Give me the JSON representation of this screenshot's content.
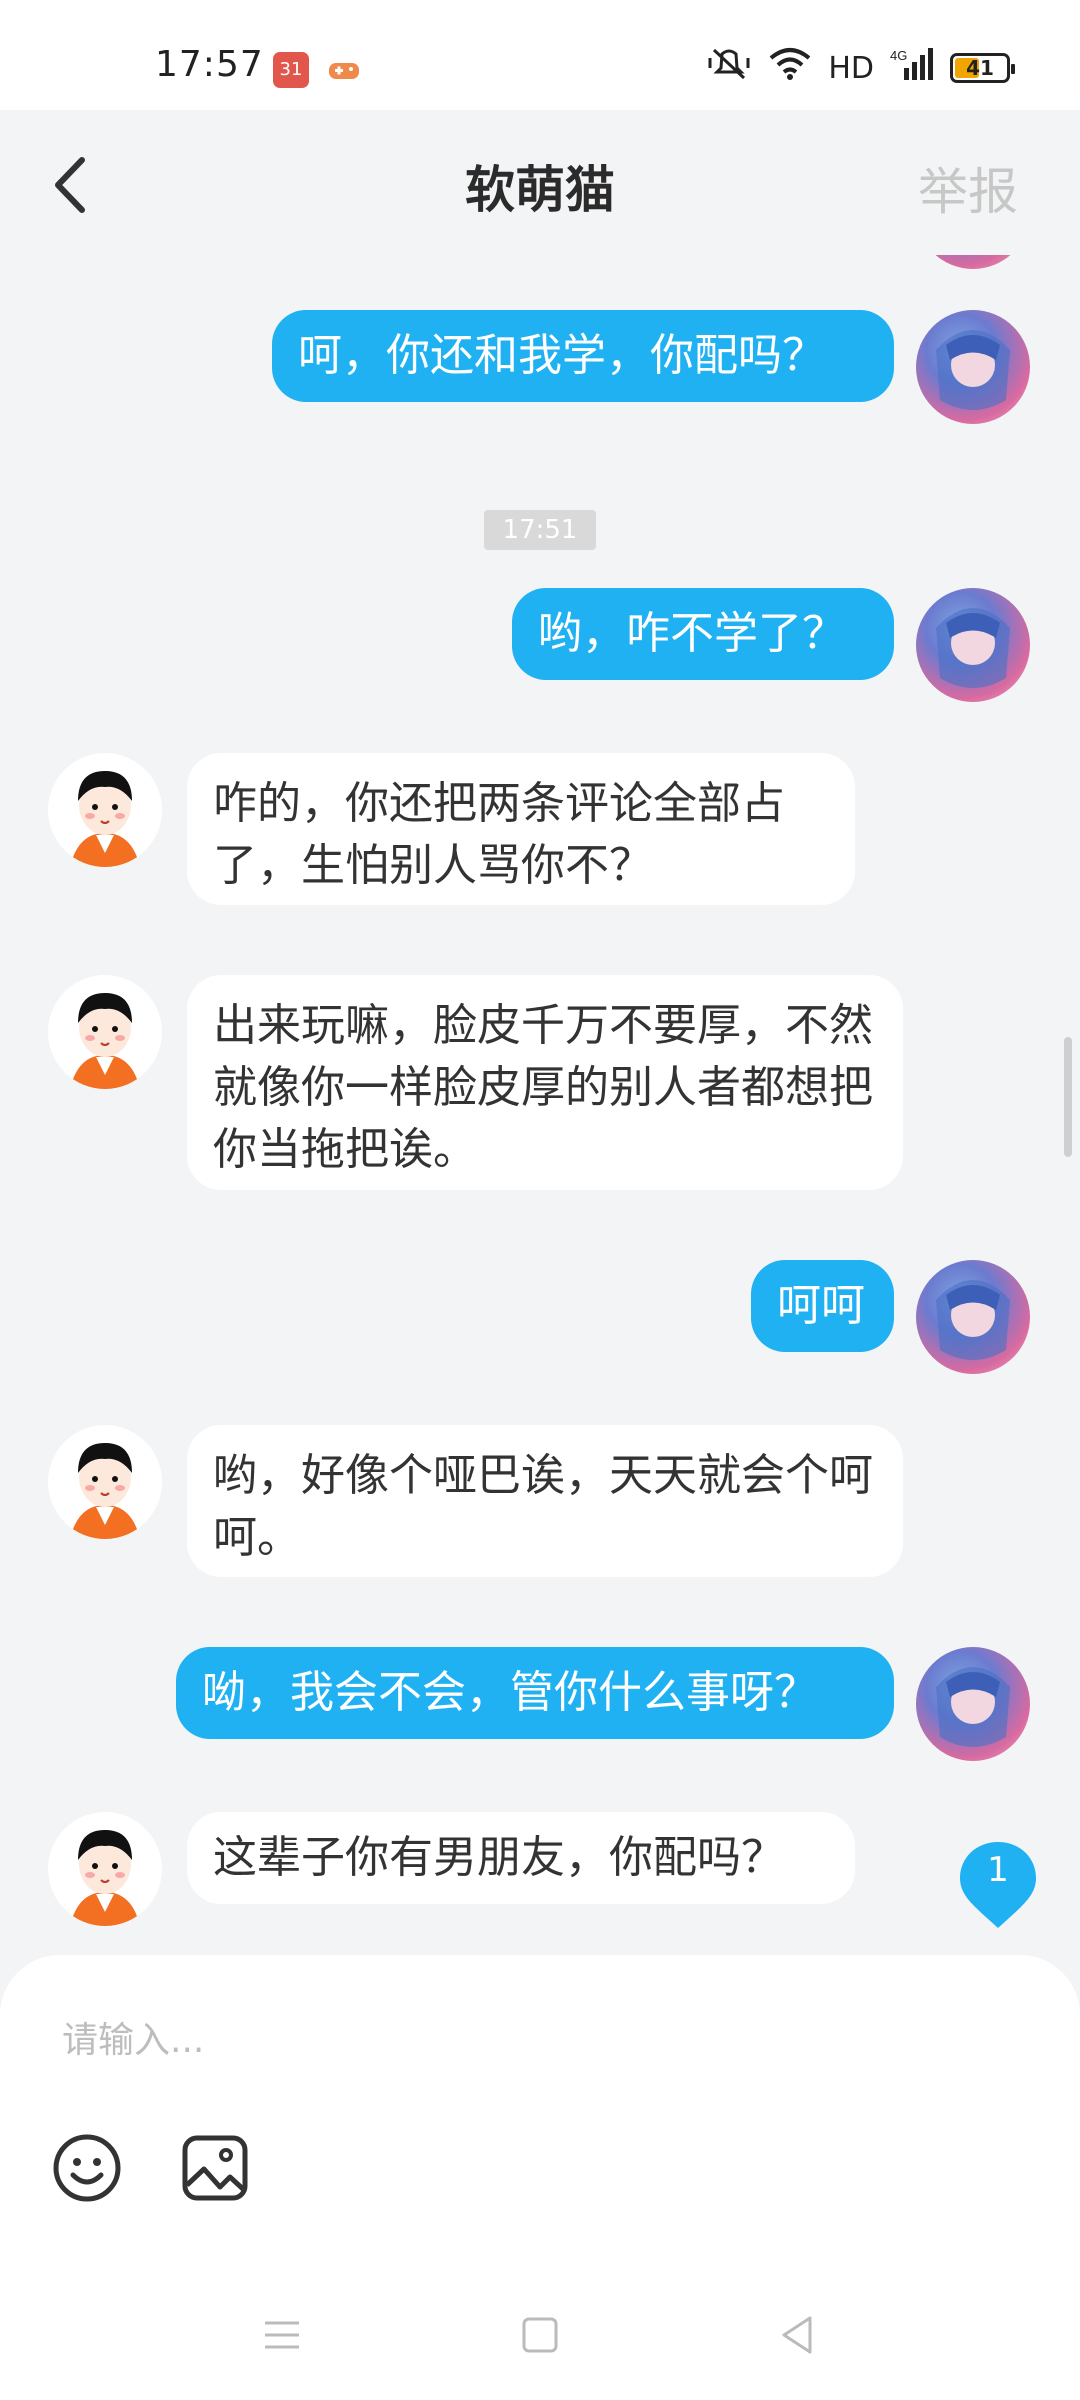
{
  "status_bar": {
    "time": "17:57",
    "calendar_day": "31",
    "network": "HD",
    "battery": "41"
  },
  "header": {
    "title": "软萌猫",
    "report_label": "举报"
  },
  "chat": {
    "timestamp": "17:51",
    "messages": [
      {
        "from": "me",
        "text": "呵，你还和我学，你配吗？"
      },
      {
        "from": "me",
        "text": "哟，咋不学了？"
      },
      {
        "from": "other",
        "text": "咋的，你还把两条评论全部占了，生怕别人骂你不？"
      },
      {
        "from": "other",
        "text": "出来玩嘛，脸皮千万不要厚，不然就像你一样脸皮厚的别人者都想把你当拖把诶。"
      },
      {
        "from": "me",
        "text": "呵呵"
      },
      {
        "from": "other",
        "text": "哟，好像个哑巴诶，天天就会个呵呵。"
      },
      {
        "from": "me",
        "text": "呦，我会不会，管你什么事呀？"
      },
      {
        "from": "other",
        "text": "这辈子你有男朋友，你配吗？"
      }
    ],
    "unread_count": "1"
  },
  "input": {
    "placeholder": "请输入..."
  },
  "colors": {
    "my_bubble": "#1fb1f2",
    "other_bubble": "#ffffff",
    "background": "#f3f4f6"
  }
}
